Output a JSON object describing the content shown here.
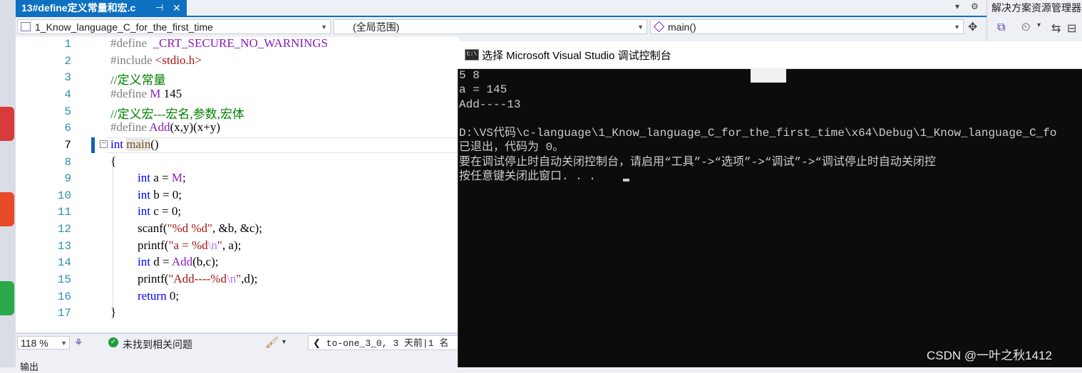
{
  "tab": {
    "title": "13#define定义常量和宏.c",
    "pin": "⊣",
    "close": "✕"
  },
  "navbar": {
    "project": "1_Know_language_C_for_the_first_time",
    "scope": "(全局范围)",
    "function": "main()"
  },
  "solution_explorer": {
    "title": "解决方案资源管理器"
  },
  "editor": {
    "line_numbers": [
      "1",
      "2",
      "3",
      "4",
      "5",
      "6",
      "7",
      "8",
      "9",
      "10",
      "11",
      "12",
      "13",
      "14",
      "15",
      "16",
      "17"
    ],
    "lines": {
      "l1a": "#define",
      "l1b": "  _CRT_SECURE_NO_WARNINGS",
      "l2a": "#include",
      "l2b": " <stdio.h>",
      "l3": "//定义常量",
      "l4a": "#define",
      "l4b": " M",
      "l4c": " 145",
      "l5": "//定义宏---宏名,参数,宏体",
      "l6a": "#define",
      "l6b": " Add",
      "l6c": "(x,y)(x+y)",
      "l7a": "int",
      "l7b": " ",
      "l7c": "main",
      "l7d": "()",
      "l8": "{",
      "l9a": "int",
      "l9b": " a = ",
      "l9c": "M",
      "l9d": ";",
      "l10a": "int",
      "l10b": " b = 0;",
      "l11a": "int",
      "l11b": " c = 0;",
      "l12a": "scanf(",
      "l12b": "\"%d %d\"",
      "l12c": ", &b, &c);",
      "l13a": "printf(",
      "l13b": "\"a = %d",
      "l13c": "\\n",
      "l13d": "\"",
      "l13e": ", a);",
      "l14a": "int",
      "l14b": " d = ",
      "l14c": "Add",
      "l14d": "(b,c);",
      "l15a": "printf(",
      "l15b": "\"Add----%d",
      "l15c": "\\n",
      "l15d": "\"",
      "l15e": ",d);",
      "l16a": "return",
      "l16b": " 0;",
      "l17": "}"
    }
  },
  "status": {
    "zoom": "118 %",
    "issues": "未找到相关问题",
    "git": "to-one_3_0, 3 天前|1 名"
  },
  "output_tab": "输出",
  "console": {
    "icon": "C:\\",
    "title": "选择 Microsoft Visual Studio 调试控制台",
    "lines": [
      "5 8",
      "a = 145",
      "Add----13",
      "",
      "D:\\VS代码\\c-language\\1_Know_language_C_for_the_first_time\\x64\\Debug\\1_Know_language_C_fo",
      "已退出，代码为 0。",
      "要在调试停止时自动关闭控制台，请启用“工具”->“选项”->“调试”->“调试停止时自动关闭控",
      "按任意键关闭此窗口. . ."
    ]
  },
  "watermark": "CSDN @一叶之秋1412",
  "colors": {
    "accent": "#0e70c0",
    "console_bg": "#0c0c0c",
    "keyword": "#0000ff",
    "comment": "#008000"
  }
}
